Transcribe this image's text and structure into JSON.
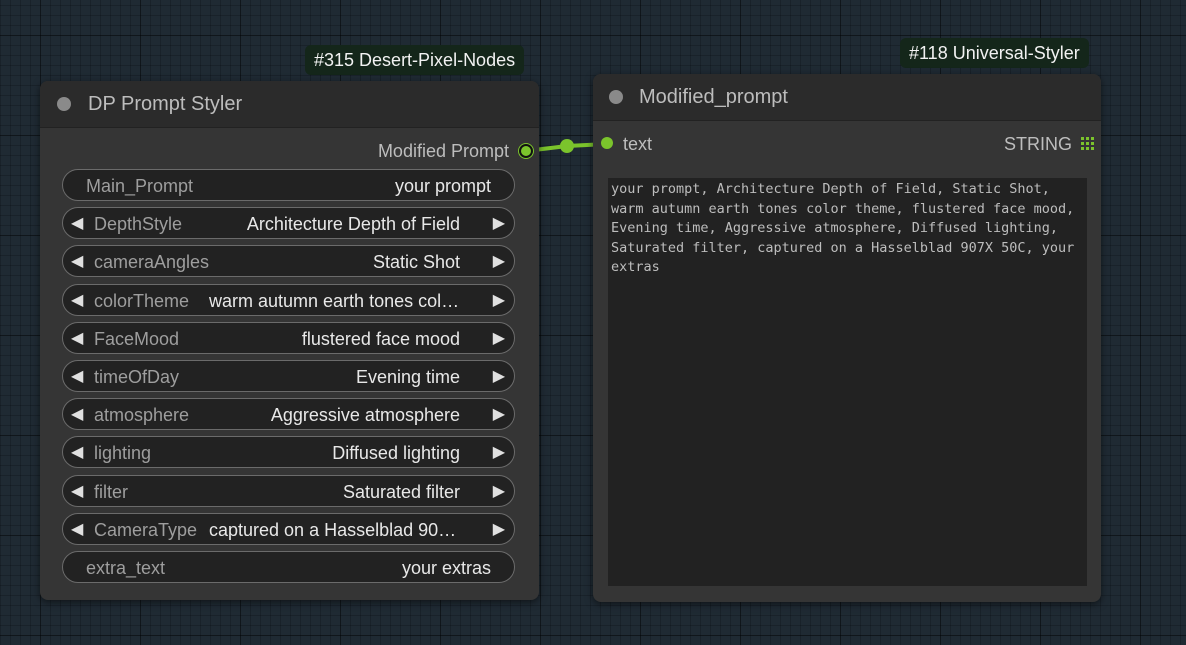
{
  "colors": {
    "canvas": "#1f2a33",
    "node_body": "#353535",
    "node_header": "#2b2b2b",
    "link_green": "#7bc42c",
    "badge_bg": "#14261a"
  },
  "node_left": {
    "badge": "#315 Desert-Pixel-Nodes",
    "title": "DP Prompt Styler",
    "output_label": "Modified Prompt",
    "widgets": [
      {
        "name": "Main_Prompt",
        "value": "your prompt",
        "type": "text"
      },
      {
        "name": "DepthStyle",
        "value": "Architecture Depth of Field",
        "type": "combo"
      },
      {
        "name": "cameraAngles",
        "value": "Static Shot",
        "type": "combo"
      },
      {
        "name": "colorTheme",
        "value": "warm autumn earth tones color theme",
        "type": "combo"
      },
      {
        "name": "FaceMood",
        "value": "flustered face mood",
        "type": "combo"
      },
      {
        "name": "timeOfDay",
        "value": "Evening time",
        "type": "combo"
      },
      {
        "name": "atmosphere",
        "value": "Aggressive atmosphere",
        "type": "combo"
      },
      {
        "name": "lighting",
        "value": "Diffused lighting",
        "type": "combo"
      },
      {
        "name": "filter",
        "value": "Saturated filter",
        "type": "combo"
      },
      {
        "name": "CameraType",
        "value": "captured on a Hasselblad 907X 50C",
        "type": "combo"
      },
      {
        "name": "extra_text",
        "value": "your extras",
        "type": "text"
      }
    ]
  },
  "node_right": {
    "badge": "#118 Universal-Styler",
    "title": "Modified_prompt",
    "input_label": "text",
    "type_label": "STRING",
    "text_content": "your prompt, Architecture Depth of Field, Static Shot, warm autumn earth tones color theme, flustered face mood, Evening time, Aggressive atmosphere, Diffused lighting, Saturated filter, captured on a Hasselblad 907X 50C, your extras"
  },
  "icons": {
    "arrow_left": "◀",
    "arrow_right": "▶",
    "grid_icon": "grid-icon",
    "collapse_dot": "node-collapse-dot-icon"
  }
}
